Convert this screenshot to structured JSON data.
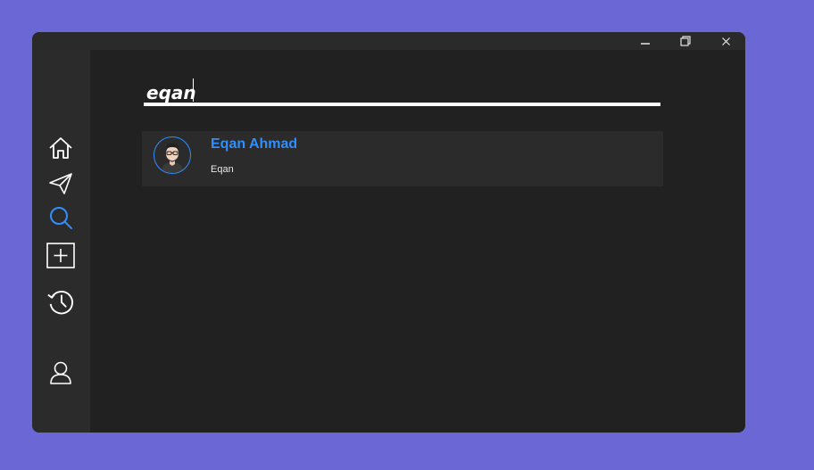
{
  "window": {
    "controls": {
      "minimize_icon": "minimize-icon",
      "restore_icon": "restore-icon",
      "close_icon": "close-icon"
    }
  },
  "sidebar": {
    "items": [
      {
        "name": "home",
        "icon": "home-icon",
        "active": false
      },
      {
        "name": "send",
        "icon": "send-icon",
        "active": false
      },
      {
        "name": "search",
        "icon": "search-icon",
        "active": true
      },
      {
        "name": "add",
        "icon": "add-icon",
        "active": false
      },
      {
        "name": "history",
        "icon": "history-icon",
        "active": false
      },
      {
        "name": "profile",
        "icon": "user-icon",
        "active": false
      }
    ]
  },
  "search": {
    "value": "eqan"
  },
  "results": [
    {
      "display_name": "Eqan Ahmad",
      "username": "Eqan",
      "avatar_icon": "avatar-icon"
    }
  ],
  "colors": {
    "background": "#6b68d6",
    "window": "#212121",
    "sidebar": "#2b2b2b",
    "accent": "#2f8fff",
    "text": "#ffffff"
  }
}
